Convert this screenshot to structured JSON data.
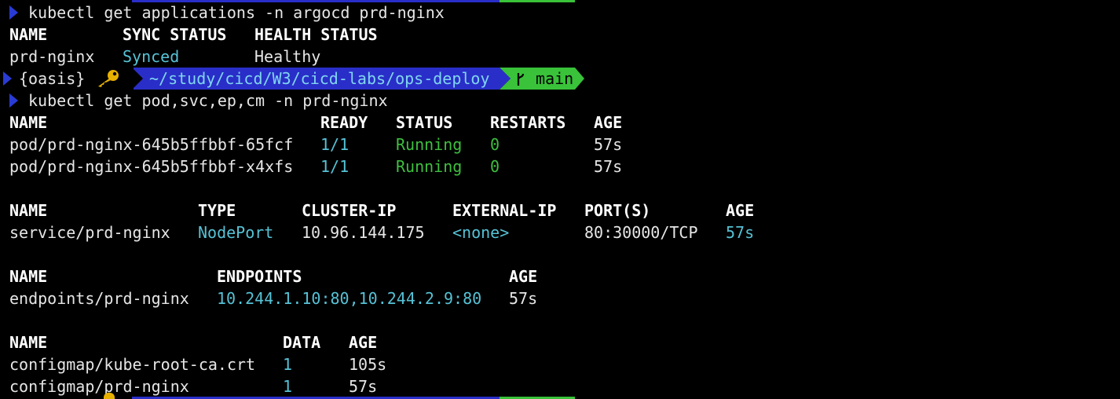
{
  "commands": {
    "cmd1": "kubectl get applications -n argocd prd-nginx",
    "cmd2": "kubectl get pod,svc,ep,cm -n prd-nginx"
  },
  "prompt": {
    "context": "{oasis}",
    "key_icon": "key-icon",
    "directory": "~/study/cicd/W3/cicd-labs/ops-deploy",
    "branch_icon": "git-branch-icon",
    "branch": "main"
  },
  "applications": {
    "headers": [
      "NAME",
      "SYNC STATUS",
      "HEALTH STATUS"
    ],
    "rows": [
      [
        "prd-nginx",
        "Synced",
        "Healthy"
      ]
    ]
  },
  "pods": {
    "headers": [
      "NAME",
      "READY",
      "STATUS",
      "RESTARTS",
      "AGE"
    ],
    "rows": [
      [
        "pod/prd-nginx-645b5ffbbf-65fcf",
        "1/1",
        "Running",
        "0",
        "57s"
      ],
      [
        "pod/prd-nginx-645b5ffbbf-x4xfs",
        "1/1",
        "Running",
        "0",
        "57s"
      ]
    ]
  },
  "services": {
    "headers": [
      "NAME",
      "TYPE",
      "CLUSTER-IP",
      "EXTERNAL-IP",
      "PORT(S)",
      "AGE"
    ],
    "rows": [
      [
        "service/prd-nginx",
        "NodePort",
        "10.96.144.175",
        "<none>",
        "80:30000/TCP",
        "57s"
      ]
    ]
  },
  "endpoints": {
    "headers": [
      "NAME",
      "ENDPOINTS",
      "AGE"
    ],
    "rows": [
      [
        "endpoints/prd-nginx",
        "10.244.1.10:80,10.244.2.9:80",
        "57s"
      ]
    ]
  },
  "configmaps": {
    "headers": [
      "NAME",
      "DATA",
      "AGE"
    ],
    "rows": [
      [
        "configmap/kube-root-ca.crt",
        "1",
        "105s"
      ],
      [
        "configmap/prd-nginx",
        "1",
        "57s"
      ]
    ]
  },
  "colors": {
    "background": "#000000",
    "text": "#e6e6e6",
    "cyan": "#56c2d6",
    "green": "#3fbf3f",
    "prompt_blue": "#2a2ec8",
    "prompt_green": "#39c23a"
  }
}
